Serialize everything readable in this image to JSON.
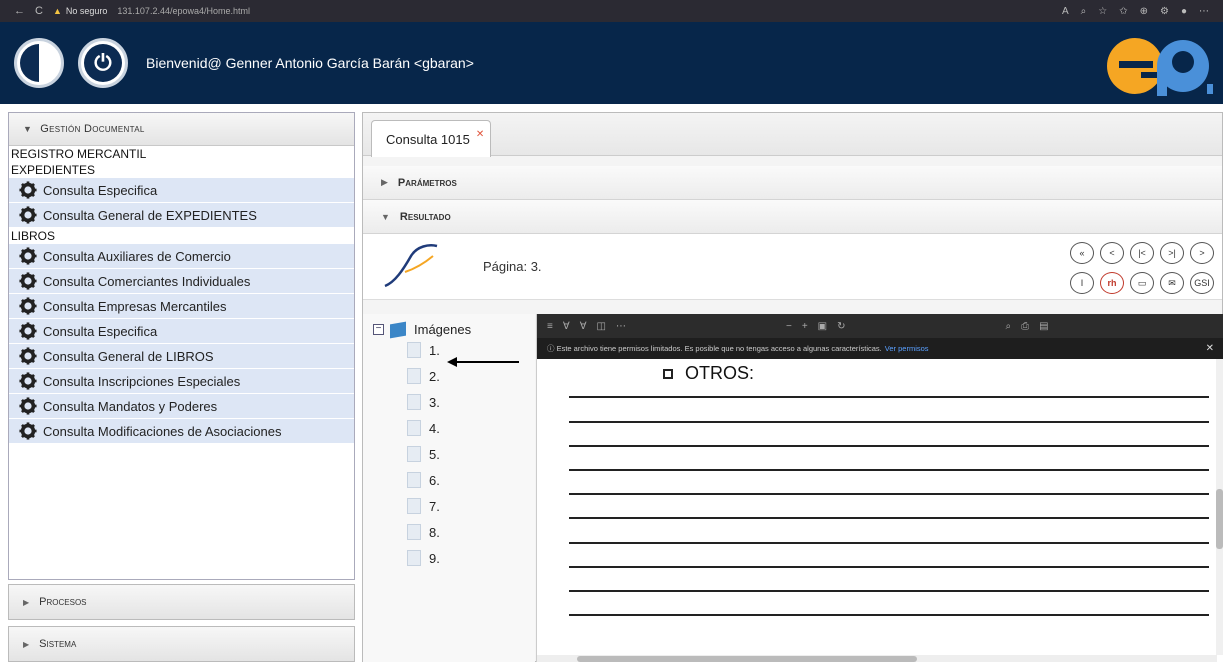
{
  "browser": {
    "security_label": "No seguro",
    "address": "131.107.2.44/epowa4/Home.html"
  },
  "header": {
    "welcome": "Bienvenid@ Genner Antonio García Barán <gbaran>"
  },
  "sidebar": {
    "section_title": "Gestión Documental",
    "registro": "REGISTRO MERCANTIL",
    "expedientes": "EXPEDIENTES",
    "expedientes_items": [
      "Consulta Especifica",
      "Consulta General de EXPEDIENTES"
    ],
    "libros": "LIBROS",
    "libros_items": [
      "Consulta Auxiliares de Comercio",
      "Consulta Comerciantes Individuales",
      "Consulta Empresas Mercantiles",
      "Consulta Especifica",
      "Consulta General de LIBROS",
      "Consulta Inscripciones Especiales",
      "Consulta Mandatos y Poderes",
      "Consulta Modificaciones de Asociaciones"
    ],
    "procesos": "Procesos",
    "sistema": "Sistema"
  },
  "main": {
    "tab_label": "Consulta 1015",
    "parametros": "Parámetros",
    "resultado": "Resultado",
    "pagina": "Página: 3.",
    "nav_row1": [
      "«",
      "<",
      "|<",
      ">|",
      ">"
    ],
    "nav_row2": [
      "I",
      "rh",
      "▭",
      "✉",
      "GSI"
    ],
    "tree_root": "Imágenes",
    "tree_items": [
      "1.",
      "2.",
      "3.",
      "4.",
      "5.",
      "6.",
      "7.",
      "8.",
      "9."
    ],
    "viewer_info": "Este archivo tiene permisos limitados. Es posible que no tengas acceso a algunas características.",
    "viewer_link": "Ver permisos",
    "document_heading": "OTROS:"
  },
  "colors": {
    "header_bg": "#07264a",
    "menu_item_bg": "#dde6f5",
    "accent_orange": "#f5a623",
    "accent_blue": "#4a90d9"
  }
}
